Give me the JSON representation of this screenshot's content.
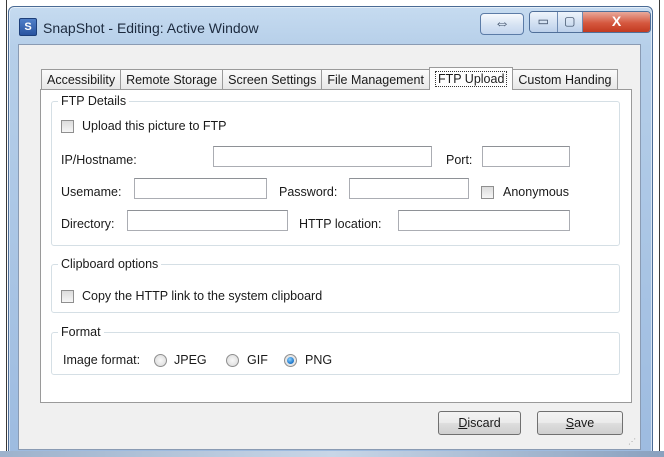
{
  "window": {
    "title": "SnapShot - Editing: Active Window",
    "app_icon_letter": "S",
    "swap_glyph": "⇔",
    "min_glyph": "▭",
    "max_glyph": "▢",
    "close_glyph": "X"
  },
  "tabs": [
    {
      "label": "Accessibility",
      "active": false
    },
    {
      "label": "Remote Storage",
      "active": false
    },
    {
      "label": "Screen Settings",
      "active": false
    },
    {
      "label": "File Management",
      "active": false
    },
    {
      "label": "FTP Upload",
      "active": true
    },
    {
      "label": "Custom Handing",
      "active": false
    }
  ],
  "ftp_details": {
    "legend": "FTP Details",
    "upload_label": "Upload this picture to FTP",
    "upload_checked": false,
    "host_label": "IP/Hostname:",
    "host_value": "",
    "port_label": "Port:",
    "port_value": "",
    "username_label": "Usemame:",
    "username_value": "",
    "password_label": "Password:",
    "password_value": "",
    "anonymous_label": "Anonymous",
    "anonymous_checked": false,
    "directory_label": "Directory:",
    "directory_value": "",
    "http_label": "HTTP location:",
    "http_value": ""
  },
  "clipboard": {
    "legend": "Clipboard options",
    "copy_label": "Copy the HTTP link to the system clipboard",
    "copy_checked": false
  },
  "format": {
    "legend": "Format",
    "image_format_label": "Image format:",
    "options": [
      {
        "label": "JPEG",
        "selected": false
      },
      {
        "label": "GIF",
        "selected": false
      },
      {
        "label": "PNG",
        "selected": true
      }
    ]
  },
  "buttons": {
    "discard_accel": "D",
    "discard_rest": "iscard",
    "save_accel": "S",
    "save_rest": "ave"
  },
  "colors": {
    "title_bar": "#b6cfe9",
    "close_button": "#d5583f",
    "radio_selected": "#1a73c8"
  }
}
